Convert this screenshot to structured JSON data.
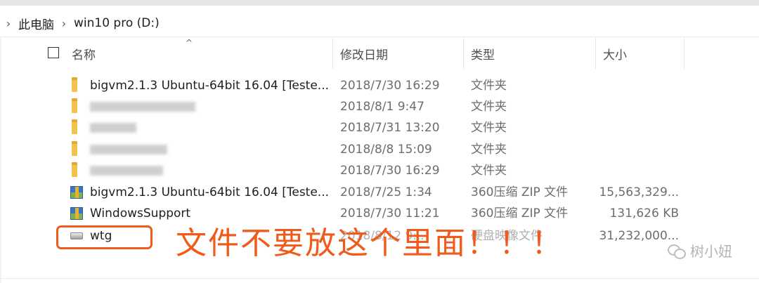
{
  "breadcrumb": {
    "items": [
      "此电脑",
      "win10 pro (D:)"
    ]
  },
  "columns": {
    "name": "名称",
    "date": "修改日期",
    "type": "类型",
    "size": "大小"
  },
  "rows": [
    {
      "name": "bigvm2.1.3 Ubuntu-64bit 16.04 [Teste...",
      "date": "2018/7/30 16:29",
      "type": "文件夹",
      "size": "",
      "icon": "folder-icon"
    },
    {
      "name": "",
      "date": "2018/8/1 9:47",
      "type": "文件夹",
      "size": "",
      "icon": "folder-icon"
    },
    {
      "name": "",
      "date": "2018/7/31 13:20",
      "type": "文件夹",
      "size": "",
      "icon": "folder-icon"
    },
    {
      "name": "",
      "date": "2018/8/8 15:09",
      "type": "文件夹",
      "size": "",
      "icon": "folder-icon"
    },
    {
      "name": "",
      "date": "2018/7/30 16:29",
      "type": "文件夹",
      "size": "",
      "icon": "folder-icon"
    },
    {
      "name": "bigvm2.1.3 Ubuntu-64bit 16.04 [Teste...",
      "date": "2018/7/25 1:34",
      "type": "360压缩 ZIP 文件",
      "size": "15,563,329...",
      "icon": "zip-archive-icon"
    },
    {
      "name": "WindowsSupport",
      "date": "2018/7/30 11:21",
      "type": "360压缩 ZIP 文件",
      "size": "131,626 KB",
      "icon": "zip-archive-icon"
    },
    {
      "name": "wtg",
      "date": "2018/8/12 9:..",
      "type": "硬盘映像文件",
      "size": "31,232,000...",
      "icon": "disk-image-icon"
    }
  ],
  "annotation": {
    "text": "文件不要放这个里面！！！",
    "color": "#f05a1a"
  },
  "watermark": {
    "text": "树小妞"
  },
  "colors": {
    "folder": "#f2c14e",
    "text_secondary": "#6d6d6d",
    "accent": "#f05a1a"
  }
}
